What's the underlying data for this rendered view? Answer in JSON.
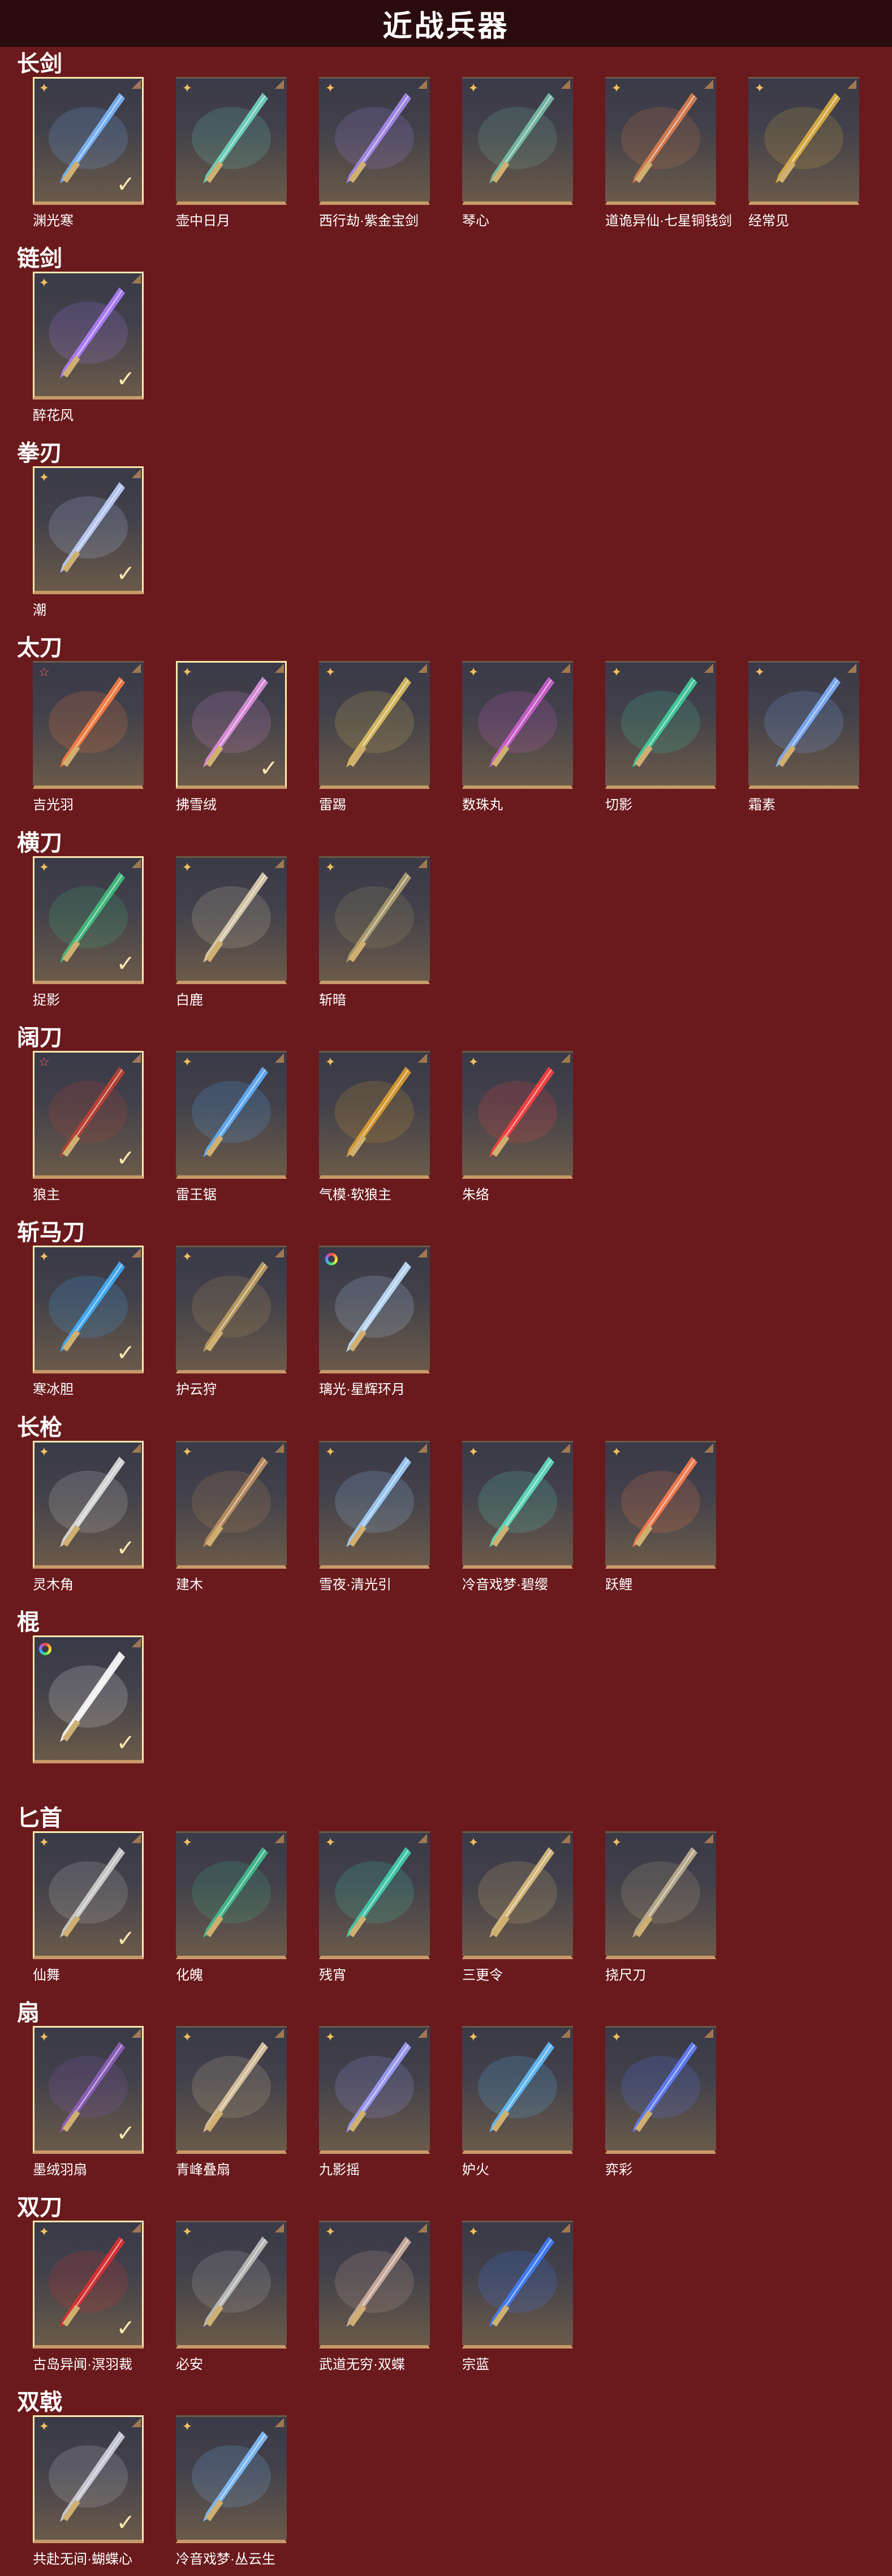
{
  "header": {
    "title": "近战兵器"
  },
  "colors": {
    "background": "#6a1a1c",
    "header_bg": "#2b0c0e",
    "card_border_owned": "#ffe9b0",
    "card_bottom_bar": "#c89a6a",
    "rarity_gold": "#f0c060",
    "rarity_red": "#ff5c70"
  },
  "categories": [
    {
      "title": "长剑",
      "items": [
        {
          "name": "渊光寒",
          "rarity": "gold",
          "owned": true,
          "hue": "#7ab8ff"
        },
        {
          "name": "壶中日月",
          "rarity": "gold",
          "owned": false,
          "hue": "#6fd6c2"
        },
        {
          "name": "西行劫·紫金宝剑",
          "rarity": "gold",
          "owned": false,
          "hue": "#a78cf0"
        },
        {
          "name": "琴心",
          "rarity": "gold",
          "owned": false,
          "hue": "#78c0a8"
        },
        {
          "name": "道诡异仙·七星铜钱剑",
          "rarity": "gold",
          "owned": false,
          "hue": "#e08050"
        },
        {
          "name": "经常见",
          "rarity": "gold",
          "owned": false,
          "hue": "#e0b040"
        }
      ]
    },
    {
      "title": "链剑",
      "items": [
        {
          "name": "醉花风",
          "rarity": "gold",
          "owned": true,
          "hue": "#b080ff"
        }
      ]
    },
    {
      "title": "拳刃",
      "items": [
        {
          "name": "潮",
          "rarity": "gold",
          "owned": true,
          "hue": "#c0d0ff"
        }
      ]
    },
    {
      "title": "太刀",
      "items": [
        {
          "name": "吉光羽",
          "rarity": "star",
          "owned": false,
          "hue": "#ff8040"
        },
        {
          "name": "拂雪绒",
          "rarity": "gold",
          "owned": true,
          "hue": "#e090e0"
        },
        {
          "name": "雷踢",
          "rarity": "gold",
          "owned": false,
          "hue": "#e0c060"
        },
        {
          "name": "数珠丸",
          "rarity": "gold",
          "owned": false,
          "hue": "#d060d0"
        },
        {
          "name": "切影",
          "rarity": "gold",
          "owned": false,
          "hue": "#40d0a0"
        },
        {
          "name": "霜素",
          "rarity": "gold",
          "owned": false,
          "hue": "#80b0ff"
        }
      ]
    },
    {
      "title": "横刀",
      "items": [
        {
          "name": "捉影",
          "rarity": "gold",
          "owned": true,
          "hue": "#40c080"
        },
        {
          "name": "白鹿",
          "rarity": "gold",
          "owned": false,
          "hue": "#e0d0b0"
        },
        {
          "name": "斩暗",
          "rarity": "gold",
          "owned": false,
          "hue": "#b0a070"
        }
      ]
    },
    {
      "title": "阔刀",
      "items": [
        {
          "name": "狼主",
          "rarity": "star",
          "owned": true,
          "hue": "#c04030"
        },
        {
          "name": "雷王锯",
          "rarity": "gold",
          "owned": false,
          "hue": "#60b0ff"
        },
        {
          "name": "气模·软狼主",
          "rarity": "gold",
          "owned": false,
          "hue": "#e0a030"
        },
        {
          "name": "朱络",
          "rarity": "gold",
          "owned": false,
          "hue": "#ff4040"
        }
      ]
    },
    {
      "title": "斩马刀",
      "items": [
        {
          "name": "寒冰胆",
          "rarity": "gold",
          "owned": true,
          "hue": "#40b0ff"
        },
        {
          "name": "护云狩",
          "rarity": "gold",
          "owned": false,
          "hue": "#c0a060"
        },
        {
          "name": "璃光·星辉环月",
          "rarity": "rainbow",
          "owned": false,
          "hue": "#c0e0ff"
        }
      ]
    },
    {
      "title": "长枪",
      "items": [
        {
          "name": "灵木角",
          "rarity": "gold",
          "owned": true,
          "hue": "#e0e0e0"
        },
        {
          "name": "建木",
          "rarity": "gold",
          "owned": false,
          "hue": "#c09060"
        },
        {
          "name": "雪夜·清光引",
          "rarity": "gold",
          "owned": false,
          "hue": "#a0d0ff"
        },
        {
          "name": "冷音戏梦·碧缨",
          "rarity": "gold",
          "owned": false,
          "hue": "#60e0c0"
        },
        {
          "name": "跃鲤",
          "rarity": "gold",
          "owned": false,
          "hue": "#ff8050"
        }
      ]
    },
    {
      "title": "棍",
      "items": [
        {
          "name": "",
          "rarity": "rainbow",
          "owned": true,
          "hue": "#ffffff"
        }
      ]
    },
    {
      "title": "匕首",
      "items": [
        {
          "name": "仙舞",
          "rarity": "gold",
          "owned": true,
          "hue": "#d0d0d0"
        },
        {
          "name": "化魄",
          "rarity": "gold",
          "owned": false,
          "hue": "#40c090"
        },
        {
          "name": "残宵",
          "rarity": "gold",
          "owned": false,
          "hue": "#40d0b0"
        },
        {
          "name": "三更令",
          "rarity": "gold",
          "owned": false,
          "hue": "#e0c080"
        },
        {
          "name": "挠尺刀",
          "rarity": "gold",
          "owned": false,
          "hue": "#c0b090"
        }
      ]
    },
    {
      "title": "扇",
      "items": [
        {
          "name": "墨绒羽扇",
          "rarity": "gold",
          "owned": true,
          "hue": "#9060c0"
        },
        {
          "name": "青峰叠扇",
          "rarity": "gold",
          "owned": false,
          "hue": "#e0c8a0"
        },
        {
          "name": "九影摇",
          "rarity": "gold",
          "owned": false,
          "hue": "#a0a0ff"
        },
        {
          "name": "妒火",
          "rarity": "gold",
          "owned": false,
          "hue": "#60c0ff"
        },
        {
          "name": "弈彩",
          "rarity": "gold",
          "owned": false,
          "hue": "#6080ff"
        }
      ]
    },
    {
      "title": "双刀",
      "items": [
        {
          "name": "古岛异闻·溟羽裁",
          "rarity": "gold",
          "owned": true,
          "hue": "#e03030"
        },
        {
          "name": "必安",
          "rarity": "gold",
          "owned": false,
          "hue": "#c0c0c0"
        },
        {
          "name": "武道无穷·双蝶",
          "rarity": "gold",
          "owned": false,
          "hue": "#d0b0a0"
        },
        {
          "name": "宗蓝",
          "rarity": "gold",
          "owned": false,
          "hue": "#4080ff"
        }
      ]
    },
    {
      "title": "双戟",
      "items": [
        {
          "name": "共赴无间·蝴蝶心",
          "rarity": "gold",
          "owned": true,
          "hue": "#d0d0e0"
        },
        {
          "name": "冷音戏梦·丛云生",
          "rarity": "gold",
          "owned": false,
          "hue": "#80c0ff"
        }
      ]
    }
  ]
}
